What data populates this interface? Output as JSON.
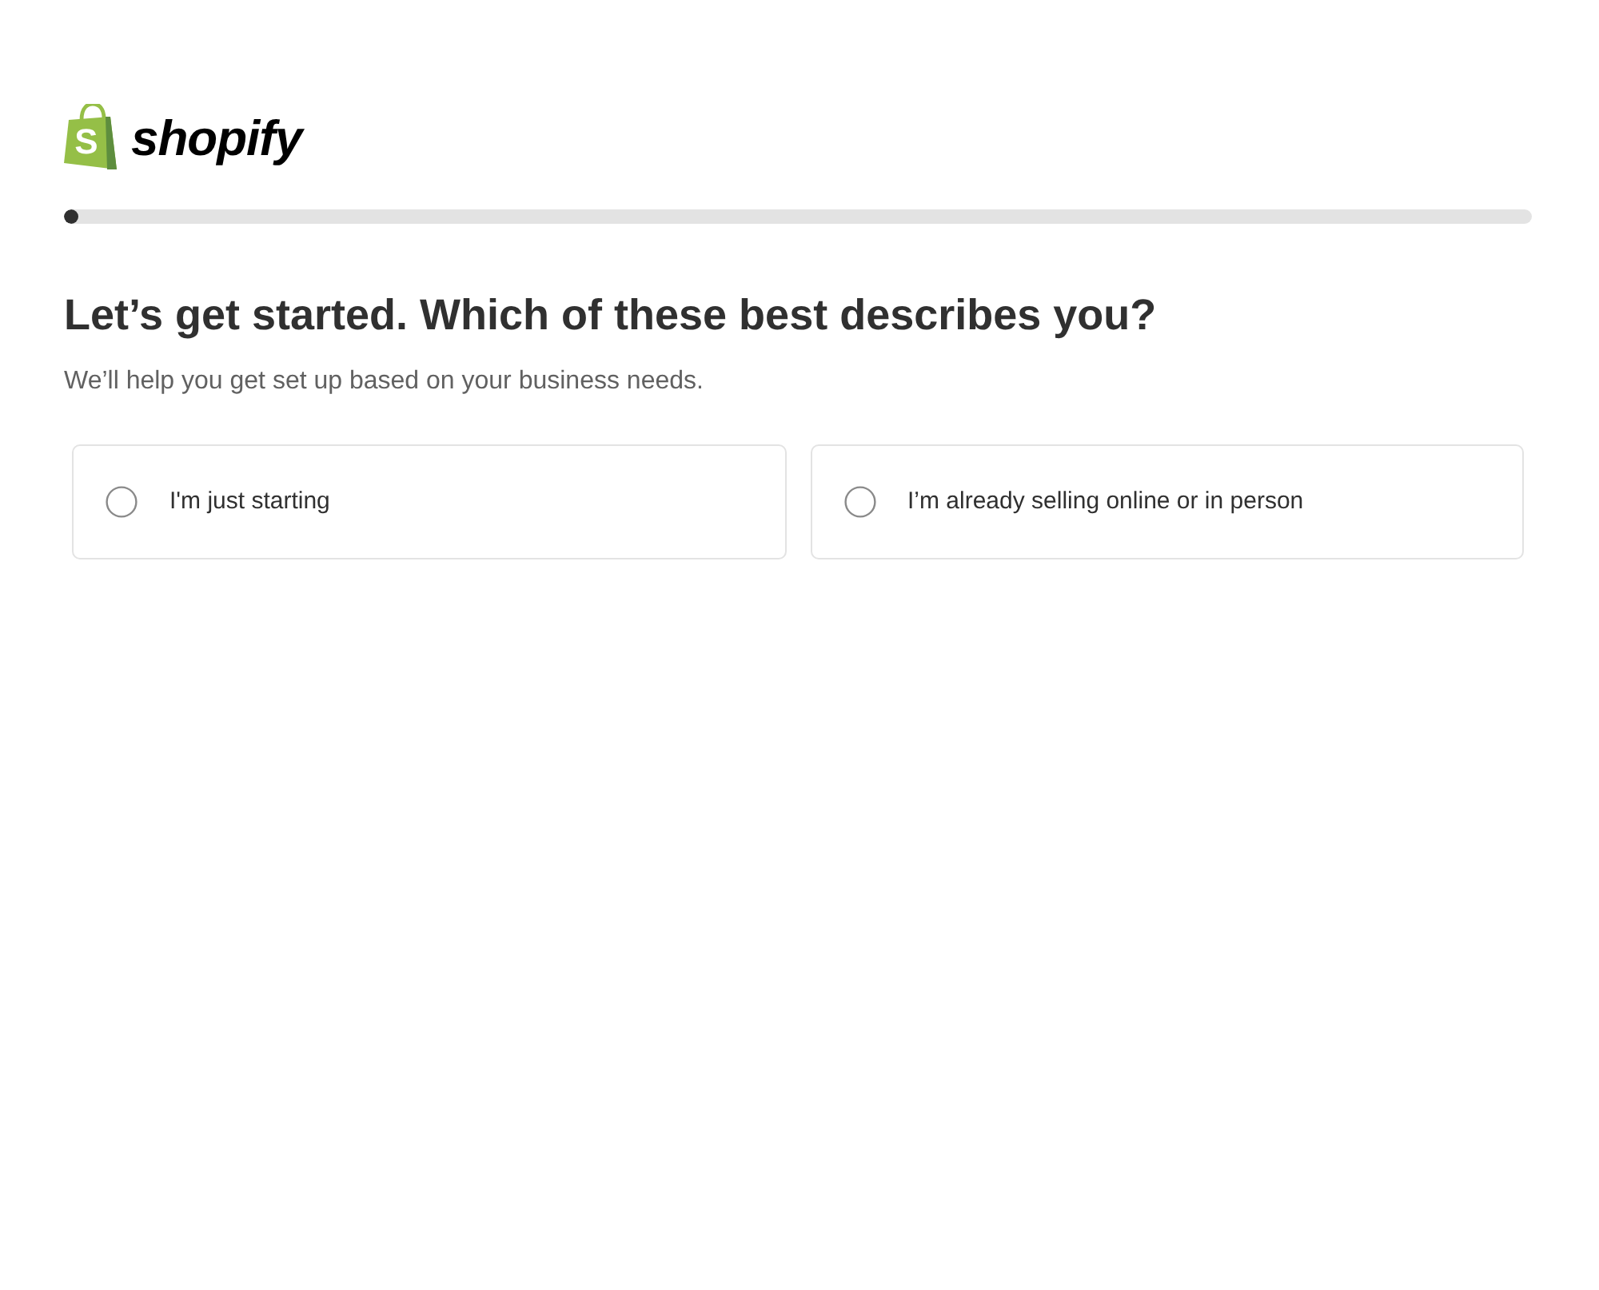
{
  "logo": {
    "mark": "S",
    "wordmark": "shopify"
  },
  "progress": {
    "level": 0.01
  },
  "heading": "Let’s get started. Which of these best describes you?",
  "subheading": "We’ll help you get set up based on your business needs.",
  "options": [
    {
      "label": "I'm just starting",
      "selected": false
    },
    {
      "label": "I’m already selling online or in person",
      "selected": false
    }
  ]
}
